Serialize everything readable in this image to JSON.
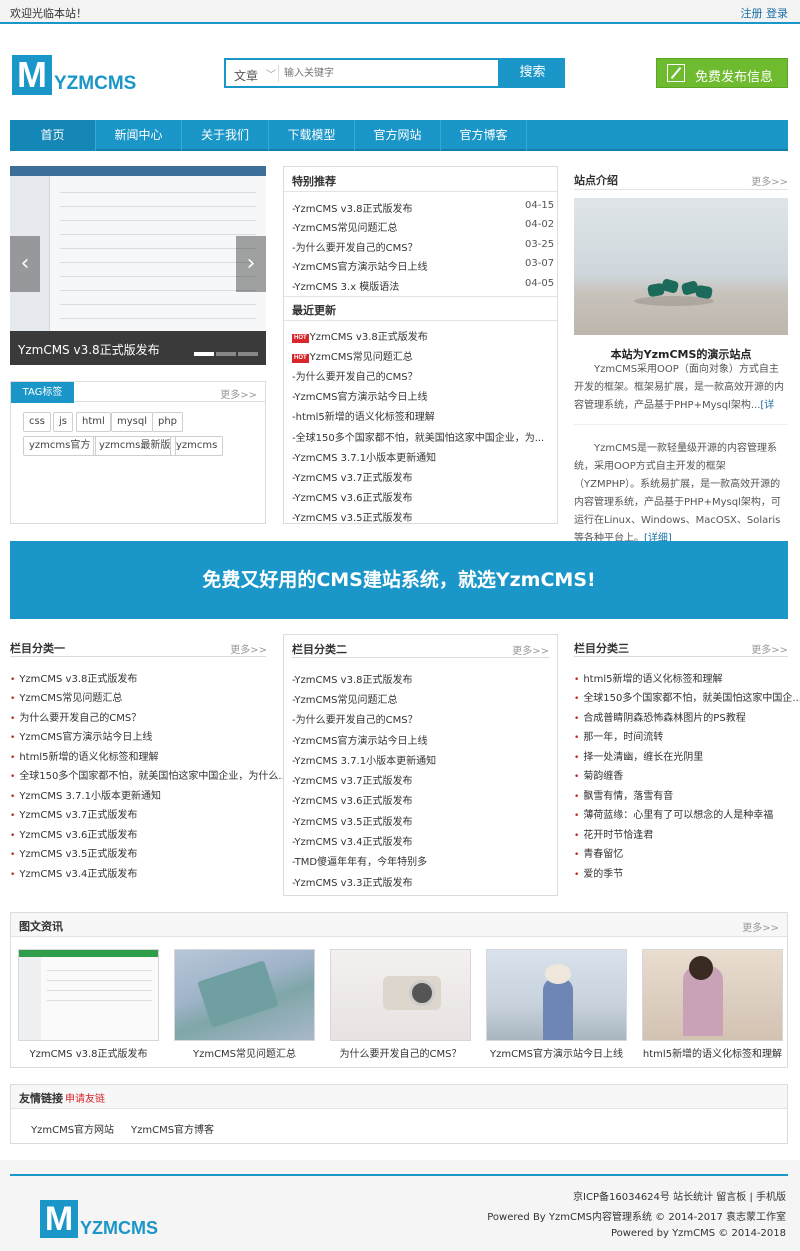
{
  "topbar": {
    "welcome": "欢迎光临本站！",
    "register": "注册",
    "login": "登录"
  },
  "logo": {
    "letter": "M",
    "text": "YZMCMS"
  },
  "search": {
    "category": "文章",
    "placeholder": "输入关键字",
    "button": "搜索"
  },
  "publish": {
    "label": "免费发布信息"
  },
  "nav": [
    "首页",
    "新闻中心",
    "关于我们",
    "下载模型",
    "官方网站",
    "官方博客"
  ],
  "slider": {
    "caption": "YzmCMS v3.8正式版发布",
    "prev": "‹",
    "next": "›"
  },
  "tags": {
    "title": "TAG标签",
    "more": "更多>>",
    "items": [
      "css",
      "js",
      "html",
      "mysql",
      "php",
      "yzmcms官方",
      "yzmcms最新版",
      "yzmcms"
    ]
  },
  "featured": {
    "title": "特别推荐",
    "items": [
      {
        "text": "-YzmCMS v3.8正式版发布",
        "date": "04-15"
      },
      {
        "text": "-YzmCMS常见问题汇总",
        "date": "04-02"
      },
      {
        "text": "-为什么要开发自己的CMS？",
        "date": "03-25"
      },
      {
        "text": "-YzmCMS官方演示站今日上线",
        "date": "03-07"
      },
      {
        "text": "-YzmCMS 3.x 模版语法",
        "date": "04-05"
      }
    ]
  },
  "recent": {
    "title": "最近更新",
    "hot": "HOT",
    "items": [
      {
        "text": "YzmCMS v3.8正式版发布",
        "hot": true
      },
      {
        "text": "YzmCMS常见问题汇总",
        "hot": true
      },
      {
        "text": "-为什么要开发自己的CMS？",
        "hot": false
      },
      {
        "text": "-YzmCMS官方演示站今日上线",
        "hot": false
      },
      {
        "text": "-html5新增的语义化标签和理解",
        "hot": false
      },
      {
        "text": "-全球150多个国家都不怕，就美国怕这家中国企业，为...",
        "hot": false
      },
      {
        "text": "-YzmCMS 3.7.1小版本更新通知",
        "hot": false
      },
      {
        "text": "-YzmCMS v3.7正式版发布",
        "hot": false
      },
      {
        "text": "-YzmCMS v3.6正式版发布",
        "hot": false
      },
      {
        "text": "-YzmCMS v3.5正式版发布",
        "hot": false
      }
    ]
  },
  "intro": {
    "title": "站点介绍",
    "more": "更多>>",
    "subtitle": "本站为YzmCMS的演示站点",
    "para1": "YzmCMS采用OOP（面向对象）方式自主开发的框架。框架易扩展，是一款高效开源的内容管理系统，产品基于PHP+Mysql架构...",
    "detail": "[详细]",
    "para2": "YzmCMS是一款轻量级开源的内容管理系统，采用OOP方式自主开发的框架（YZMPHP）。系统易扩展，是一款高效开源的内容管理系统，产品基于PHP+Mysql架构，可运行在Linux、Windows、MacOSX、Solaris等各种平台上。"
  },
  "banner": {
    "text": "免费又好用的CMS建站系统，就选YzmCMS!"
  },
  "cat1": {
    "title": "栏目分类一",
    "more": "更多>>",
    "items": [
      "YzmCMS v3.8正式版发布",
      "YzmCMS常见问题汇总",
      "为什么要开发自己的CMS？",
      "YzmCMS官方演示站今日上线",
      "html5新增的语义化标签和理解",
      "全球150多个国家都不怕，就美国怕这家中国企业，为什么...",
      "YzmCMS 3.7.1小版本更新通知",
      "YzmCMS v3.7正式版发布",
      "YzmCMS v3.6正式版发布",
      "YzmCMS v3.5正式版发布",
      "YzmCMS v3.4正式版发布"
    ]
  },
  "cat2": {
    "title": "栏目分类二",
    "more": "更多>>",
    "items": [
      "-YzmCMS v3.8正式版发布",
      "-YzmCMS常见问题汇总",
      "-为什么要开发自己的CMS？",
      "-YzmCMS官方演示站今日上线",
      "-YzmCMS 3.7.1小版本更新通知",
      "-YzmCMS v3.7正式版发布",
      "-YzmCMS v3.6正式版发布",
      "-YzmCMS v3.5正式版发布",
      "-YzmCMS v3.4正式版发布",
      "-TMD傻逼年年有，今年特别多",
      "-YzmCMS v3.3正式版发布"
    ]
  },
  "cat3": {
    "title": "栏目分类三",
    "more": "更多>>",
    "items": [
      "html5新增的语义化标签和理解",
      "全球150多个国家都不怕，就美国怕这家中国企...",
      "合成普睛阴森恐怖森林图片的PS教程",
      "那一年，时间流转",
      "择一处清幽，缠长在光阴里",
      "菊韵缠香",
      "飘雪有情，落雪有音",
      "薄荷蓝缘：心里有了可以想念的人是种幸福",
      "花开时节恰逢君",
      "青春留忆",
      "爱的季节"
    ]
  },
  "imgnews": {
    "title": "图文资讯",
    "more": "更多>>",
    "items": [
      "YzmCMS v3.8正式版发布",
      "YzmCMS常见问题汇总",
      "为什么要开发自己的CMS？",
      "YzmCMS官方演示站今日上线",
      "html5新增的语义化标签和理解"
    ]
  },
  "links": {
    "title": "友情链接",
    "apply": "申请友链",
    "items": [
      "YzmCMS官方网站",
      "YzmCMS官方博客"
    ]
  },
  "footer": {
    "line1": "京ICP备16034624号  站长统计  留言板 | 手机版",
    "line2": "Powered By YzmCMS内容管理系统 © 2014-2017 袁志蒙工作室",
    "line3": "Powered by  YzmCMS  © 2014-2018"
  },
  "colors": {
    "accent": "#1a96c8",
    "green": "#6fbb2f",
    "hot": "#d9262b"
  }
}
